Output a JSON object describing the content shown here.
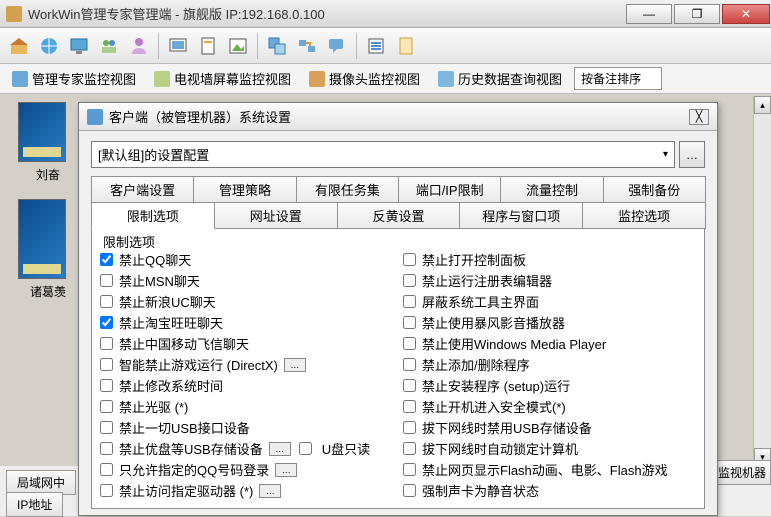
{
  "app": {
    "title": "WorkWin管理专家管理端 - 旗舰版 IP:192.168.0.100"
  },
  "viewbar": {
    "items": [
      "管理专家监控视图",
      "电视墙屏幕监控视图",
      "摄像头监控视图",
      "历史数据查询视图"
    ],
    "sort_label": "按备注排序"
  },
  "thumbs": {
    "label1": "刘奋",
    "label2": "诸葛羡"
  },
  "bottom": {
    "tab1": "局域网中",
    "tab2": "IP地址",
    "side": "监视机器"
  },
  "dialog": {
    "title": "客户端（被管理机器）系统设置",
    "combo_value": "[默认组]的设置配置",
    "tabs_row1": [
      "客户端设置",
      "管理策略",
      "有限任务集",
      "端口/IP限制",
      "流量控制",
      "强制备份"
    ],
    "tabs_row2": [
      "限制选项",
      "网址设置",
      "反黄设置",
      "程序与窗口项",
      "监控选项"
    ],
    "active_tab": "限制选项",
    "group_label": "限制选项",
    "extra_mid": "U盘只读",
    "checks_left": [
      {
        "label": "禁止QQ聊天",
        "checked": true
      },
      {
        "label": "禁止MSN聊天",
        "checked": false
      },
      {
        "label": "禁止新浪UC聊天",
        "checked": false
      },
      {
        "label": "禁止淘宝旺旺聊天",
        "checked": true
      },
      {
        "label": "禁止中国移动飞信聊天",
        "checked": false
      },
      {
        "label": "智能禁止游戏运行 (DirectX)",
        "checked": false,
        "badge": true
      },
      {
        "label": "禁止修改系统时间",
        "checked": false
      },
      {
        "label": "禁止光驱 (*)",
        "checked": false
      },
      {
        "label": "禁止一切USB接口设备",
        "checked": false
      },
      {
        "label": "禁止优盘等USB存储设备",
        "checked": false,
        "badge": true,
        "mid": true
      },
      {
        "label": "只允许指定的QQ号码登录",
        "checked": false,
        "badge": true
      },
      {
        "label": "禁止访问指定驱动器 (*)",
        "checked": false,
        "badge": true
      }
    ],
    "checks_right": [
      {
        "label": "禁止打开控制面板",
        "checked": false
      },
      {
        "label": "禁止运行注册表编辑器",
        "checked": false
      },
      {
        "label": "屏蔽系统工具主界面",
        "checked": false
      },
      {
        "label": "禁止使用暴风影音播放器",
        "checked": false
      },
      {
        "label": "禁止使用Windows Media Player",
        "checked": false
      },
      {
        "label": "禁止添加/删除程序",
        "checked": false
      },
      {
        "label": "禁止安装程序 (setup)运行",
        "checked": false
      },
      {
        "label": "禁止开机进入安全模式(*)",
        "checked": false
      },
      {
        "label": "拔下网线时禁用USB存储设备",
        "checked": false
      },
      {
        "label": "拔下网线时自动锁定计算机",
        "checked": false
      },
      {
        "label": "禁止网页显示Flash动画、电影、Flash游戏",
        "checked": false
      },
      {
        "label": "强制声卡为静音状态",
        "checked": false
      }
    ]
  }
}
